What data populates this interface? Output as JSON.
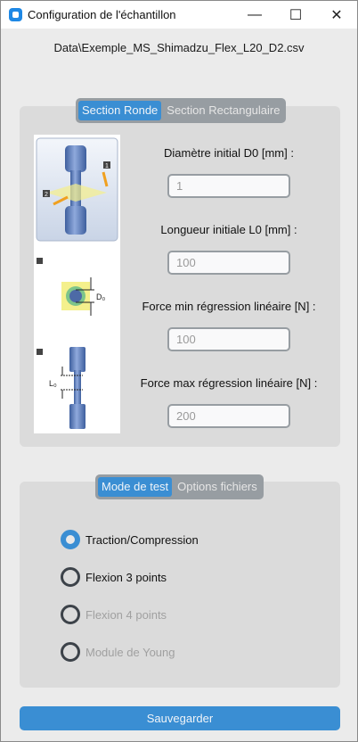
{
  "window": {
    "title": "Configuration de l'échantillon",
    "minimize": "—",
    "maximize": "☐",
    "close": "✕"
  },
  "filename": "Data\\Exemple_MS_Shimadzu_Flex_L20_D2.csv",
  "section_tabs": [
    {
      "label": "Section Ronde",
      "selected": true
    },
    {
      "label": "Section Rectangulaire",
      "selected": false
    }
  ],
  "illustration": {
    "marker1": "1",
    "marker2": "2",
    "d_label": "D₀",
    "l_label": "L₀"
  },
  "fields": [
    {
      "label": "Diamètre initial D0 [mm] :",
      "value": "1"
    },
    {
      "label": "Longueur initiale L0 [mm] :",
      "value": "100"
    },
    {
      "label": "Force min régression linéaire [N] :",
      "value": "100"
    },
    {
      "label": "Force max régression linéaire [N] :",
      "value": "200"
    }
  ],
  "mode_tabs": [
    {
      "label": "Mode de test",
      "selected": true
    },
    {
      "label": "Options fichiers",
      "selected": false
    }
  ],
  "modes": [
    {
      "label": "Traction/Compression",
      "selected": true,
      "enabled": true
    },
    {
      "label": "Flexion 3 points",
      "selected": false,
      "enabled": true
    },
    {
      "label": "Flexion 4 points",
      "selected": false,
      "enabled": false
    },
    {
      "label": "Module de Young",
      "selected": false,
      "enabled": false
    }
  ],
  "save_label": "Sauvegarder",
  "colors": {
    "accent": "#3a8ed3",
    "frame": "#dbdbdb",
    "segment": "#979da2"
  }
}
